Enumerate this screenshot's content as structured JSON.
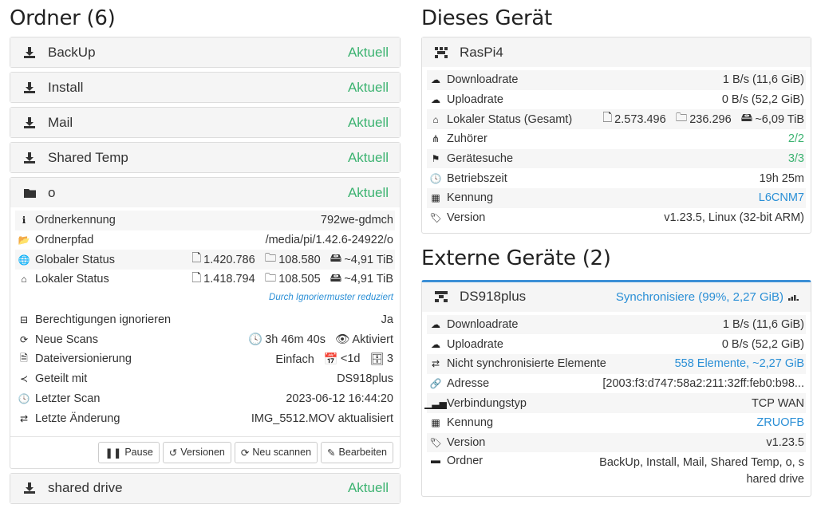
{
  "left": {
    "title": "Ordner (6)",
    "folders": [
      {
        "name": "BackUp",
        "state": "Aktuell"
      },
      {
        "name": "Install",
        "state": "Aktuell"
      },
      {
        "name": "Mail",
        "state": "Aktuell"
      },
      {
        "name": "Shared Temp",
        "state": "Aktuell"
      }
    ],
    "expanded": {
      "name": "o",
      "state": "Aktuell",
      "rows": {
        "id_label": "Ordnerkennung",
        "id_value": "792we-gdmch",
        "path_label": "Ordnerpfad",
        "path_value": "/media/pi/1.42.6-24922/o",
        "global_label": "Globaler Status",
        "global_files": "1.420.786",
        "global_dirs": "108.580",
        "global_size": "~4,91 TiB",
        "local_label": "Lokaler Status",
        "local_files": "1.418.794",
        "local_dirs": "108.505",
        "local_size": "~4,91 TiB",
        "local_note": "Durch Ignoriermuster reduziert",
        "perm_label": "Berechtigungen ignorieren",
        "perm_value": "Ja",
        "scan_label": "Neue Scans",
        "scan_interval": "3h 46m 40s",
        "scan_watch": "Aktiviert",
        "ver_label": "Dateiversionierung",
        "ver_type": "Einfach",
        "ver_age": "<1d",
        "ver_count": "3",
        "shared_label": "Geteilt mit",
        "shared_value": "DS918plus",
        "last_scan_label": "Letzter Scan",
        "last_scan_value": "2023-06-12 16:44:20",
        "last_change_label": "Letzte Änderung",
        "last_change_value": "IMG_5512.MOV aktualisiert"
      },
      "buttons": {
        "pause": "Pause",
        "versions": "Versionen",
        "rescan": "Neu scannen",
        "edit": "Bearbeiten"
      }
    },
    "last_folder": {
      "name": "shared drive",
      "state": "Aktuell"
    }
  },
  "device": {
    "title": "Dieses Gerät",
    "name": "RasPi4",
    "rows": {
      "down_label": "Downloadrate",
      "down_value": "1 B/s (11,6 GiB)",
      "up_label": "Uploadrate",
      "up_value": "0 B/s (52,2 GiB)",
      "local_label": "Lokaler Status (Gesamt)",
      "local_files": "2.573.496",
      "local_dirs": "236.296",
      "local_size": "~6,09 TiB",
      "listen_label": "Zuhörer",
      "listen_value": "2/2",
      "disc_label": "Gerätesuche",
      "disc_value": "3/3",
      "uptime_label": "Betriebszeit",
      "uptime_value": "19h 25m",
      "id_label": "Kennung",
      "id_value": "L6CNM7",
      "ver_label": "Version",
      "ver_value": "v1.23.5, Linux (32-bit ARM)"
    }
  },
  "remote": {
    "title": "Externe Geräte (2)",
    "name": "DS918plus",
    "status": "Synchronisiere (99%, 2,27 GiB)",
    "rows": {
      "down_label": "Downloadrate",
      "down_value": "1 B/s (11,6 GiB)",
      "up_label": "Uploadrate",
      "up_value": "0 B/s (52,2 GiB)",
      "oos_label": "Nicht synchronisierte Elemente",
      "oos_value": "558 Elemente, ~2,27 GiB",
      "addr_label": "Adresse",
      "addr_value": "[2003:f3:d747:58a2:211:32ff:feb0:b98...",
      "conn_label": "Verbindungstyp",
      "conn_value": "TCP WAN",
      "id_label": "Kennung",
      "id_value": "ZRUOFB",
      "ver_label": "Version",
      "ver_value": "v1.23.5",
      "folders_label": "Ordner",
      "folders_value_1": "BackUp, Install, Mail, Shared Temp, o, s",
      "folders_value_2": "hared drive"
    }
  }
}
